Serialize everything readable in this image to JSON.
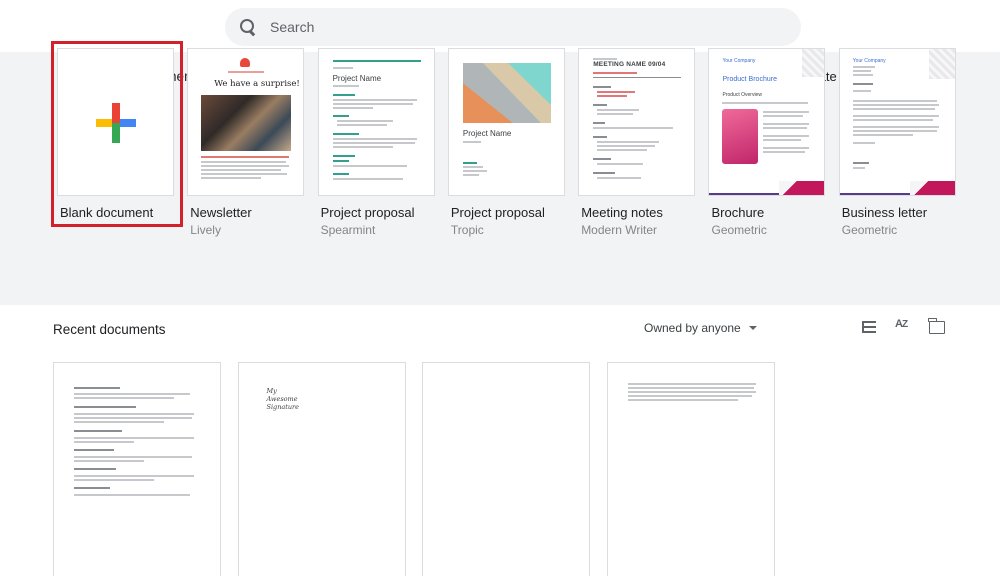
{
  "search": {
    "placeholder": "Search"
  },
  "templates_section": {
    "title": "Start a new document",
    "gallery_label": "Template gallery",
    "templates": [
      {
        "name": "Blank document",
        "sub": ""
      },
      {
        "name": "Newsletter",
        "sub": "Lively"
      },
      {
        "name": "Project proposal",
        "sub": "Spearmint"
      },
      {
        "name": "Project proposal",
        "sub": "Tropic"
      },
      {
        "name": "Meeting notes",
        "sub": "Modern Writer"
      },
      {
        "name": "Brochure",
        "sub": "Geometric"
      },
      {
        "name": "Business letter",
        "sub": "Geometric"
      }
    ],
    "thumb_text": {
      "newsletter_headline": "We have a surprise!",
      "spearmint_title": "Project Name",
      "tropic_title": "Project Name",
      "meeting_title": "MEETING NAME 09/04",
      "brochure_company": "Your Company",
      "brochure_title": "Product Brochure",
      "brochure_overview": "Product Overview",
      "letter_company": "Your Company"
    }
  },
  "recent_section": {
    "title": "Recent documents",
    "owner_filter": "Owned by anyone",
    "doc2_script": "My Awesome Signature"
  },
  "colors": {
    "band": "#f1f3f4",
    "highlight": "#d3212c",
    "google_red": "#ea4335",
    "google_yellow": "#fbbc04",
    "google_green": "#34a853",
    "google_blue": "#4285f4"
  }
}
